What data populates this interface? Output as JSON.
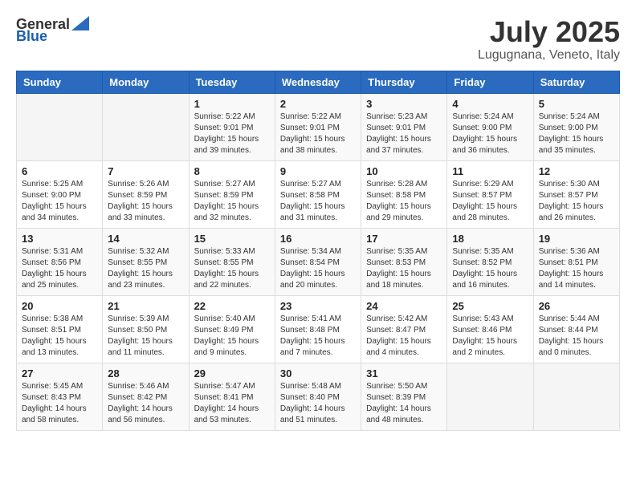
{
  "header": {
    "logo_general": "General",
    "logo_blue": "Blue",
    "month_title": "July 2025",
    "location": "Lugugnana, Veneto, Italy"
  },
  "weekdays": [
    "Sunday",
    "Monday",
    "Tuesday",
    "Wednesday",
    "Thursday",
    "Friday",
    "Saturday"
  ],
  "weeks": [
    [
      {
        "day": "",
        "sunrise": "",
        "sunset": "",
        "daylight": ""
      },
      {
        "day": "",
        "sunrise": "",
        "sunset": "",
        "daylight": ""
      },
      {
        "day": "1",
        "sunrise": "Sunrise: 5:22 AM",
        "sunset": "Sunset: 9:01 PM",
        "daylight": "Daylight: 15 hours and 39 minutes."
      },
      {
        "day": "2",
        "sunrise": "Sunrise: 5:22 AM",
        "sunset": "Sunset: 9:01 PM",
        "daylight": "Daylight: 15 hours and 38 minutes."
      },
      {
        "day": "3",
        "sunrise": "Sunrise: 5:23 AM",
        "sunset": "Sunset: 9:01 PM",
        "daylight": "Daylight: 15 hours and 37 minutes."
      },
      {
        "day": "4",
        "sunrise": "Sunrise: 5:24 AM",
        "sunset": "Sunset: 9:00 PM",
        "daylight": "Daylight: 15 hours and 36 minutes."
      },
      {
        "day": "5",
        "sunrise": "Sunrise: 5:24 AM",
        "sunset": "Sunset: 9:00 PM",
        "daylight": "Daylight: 15 hours and 35 minutes."
      }
    ],
    [
      {
        "day": "6",
        "sunrise": "Sunrise: 5:25 AM",
        "sunset": "Sunset: 9:00 PM",
        "daylight": "Daylight: 15 hours and 34 minutes."
      },
      {
        "day": "7",
        "sunrise": "Sunrise: 5:26 AM",
        "sunset": "Sunset: 8:59 PM",
        "daylight": "Daylight: 15 hours and 33 minutes."
      },
      {
        "day": "8",
        "sunrise": "Sunrise: 5:27 AM",
        "sunset": "Sunset: 8:59 PM",
        "daylight": "Daylight: 15 hours and 32 minutes."
      },
      {
        "day": "9",
        "sunrise": "Sunrise: 5:27 AM",
        "sunset": "Sunset: 8:58 PM",
        "daylight": "Daylight: 15 hours and 31 minutes."
      },
      {
        "day": "10",
        "sunrise": "Sunrise: 5:28 AM",
        "sunset": "Sunset: 8:58 PM",
        "daylight": "Daylight: 15 hours and 29 minutes."
      },
      {
        "day": "11",
        "sunrise": "Sunrise: 5:29 AM",
        "sunset": "Sunset: 8:57 PM",
        "daylight": "Daylight: 15 hours and 28 minutes."
      },
      {
        "day": "12",
        "sunrise": "Sunrise: 5:30 AM",
        "sunset": "Sunset: 8:57 PM",
        "daylight": "Daylight: 15 hours and 26 minutes."
      }
    ],
    [
      {
        "day": "13",
        "sunrise": "Sunrise: 5:31 AM",
        "sunset": "Sunset: 8:56 PM",
        "daylight": "Daylight: 15 hours and 25 minutes."
      },
      {
        "day": "14",
        "sunrise": "Sunrise: 5:32 AM",
        "sunset": "Sunset: 8:55 PM",
        "daylight": "Daylight: 15 hours and 23 minutes."
      },
      {
        "day": "15",
        "sunrise": "Sunrise: 5:33 AM",
        "sunset": "Sunset: 8:55 PM",
        "daylight": "Daylight: 15 hours and 22 minutes."
      },
      {
        "day": "16",
        "sunrise": "Sunrise: 5:34 AM",
        "sunset": "Sunset: 8:54 PM",
        "daylight": "Daylight: 15 hours and 20 minutes."
      },
      {
        "day": "17",
        "sunrise": "Sunrise: 5:35 AM",
        "sunset": "Sunset: 8:53 PM",
        "daylight": "Daylight: 15 hours and 18 minutes."
      },
      {
        "day": "18",
        "sunrise": "Sunrise: 5:35 AM",
        "sunset": "Sunset: 8:52 PM",
        "daylight": "Daylight: 15 hours and 16 minutes."
      },
      {
        "day": "19",
        "sunrise": "Sunrise: 5:36 AM",
        "sunset": "Sunset: 8:51 PM",
        "daylight": "Daylight: 15 hours and 14 minutes."
      }
    ],
    [
      {
        "day": "20",
        "sunrise": "Sunrise: 5:38 AM",
        "sunset": "Sunset: 8:51 PM",
        "daylight": "Daylight: 15 hours and 13 minutes."
      },
      {
        "day": "21",
        "sunrise": "Sunrise: 5:39 AM",
        "sunset": "Sunset: 8:50 PM",
        "daylight": "Daylight: 15 hours and 11 minutes."
      },
      {
        "day": "22",
        "sunrise": "Sunrise: 5:40 AM",
        "sunset": "Sunset: 8:49 PM",
        "daylight": "Daylight: 15 hours and 9 minutes."
      },
      {
        "day": "23",
        "sunrise": "Sunrise: 5:41 AM",
        "sunset": "Sunset: 8:48 PM",
        "daylight": "Daylight: 15 hours and 7 minutes."
      },
      {
        "day": "24",
        "sunrise": "Sunrise: 5:42 AM",
        "sunset": "Sunset: 8:47 PM",
        "daylight": "Daylight: 15 hours and 4 minutes."
      },
      {
        "day": "25",
        "sunrise": "Sunrise: 5:43 AM",
        "sunset": "Sunset: 8:46 PM",
        "daylight": "Daylight: 15 hours and 2 minutes."
      },
      {
        "day": "26",
        "sunrise": "Sunrise: 5:44 AM",
        "sunset": "Sunset: 8:44 PM",
        "daylight": "Daylight: 15 hours and 0 minutes."
      }
    ],
    [
      {
        "day": "27",
        "sunrise": "Sunrise: 5:45 AM",
        "sunset": "Sunset: 8:43 PM",
        "daylight": "Daylight: 14 hours and 58 minutes."
      },
      {
        "day": "28",
        "sunrise": "Sunrise: 5:46 AM",
        "sunset": "Sunset: 8:42 PM",
        "daylight": "Daylight: 14 hours and 56 minutes."
      },
      {
        "day": "29",
        "sunrise": "Sunrise: 5:47 AM",
        "sunset": "Sunset: 8:41 PM",
        "daylight": "Daylight: 14 hours and 53 minutes."
      },
      {
        "day": "30",
        "sunrise": "Sunrise: 5:48 AM",
        "sunset": "Sunset: 8:40 PM",
        "daylight": "Daylight: 14 hours and 51 minutes."
      },
      {
        "day": "31",
        "sunrise": "Sunrise: 5:50 AM",
        "sunset": "Sunset: 8:39 PM",
        "daylight": "Daylight: 14 hours and 48 minutes."
      },
      {
        "day": "",
        "sunrise": "",
        "sunset": "",
        "daylight": ""
      },
      {
        "day": "",
        "sunrise": "",
        "sunset": "",
        "daylight": ""
      }
    ]
  ]
}
